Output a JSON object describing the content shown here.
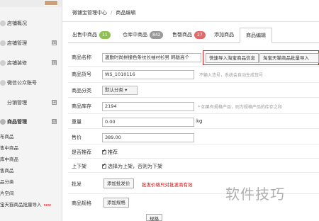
{
  "sidebar": {
    "items": [
      {
        "label": "店铺概况"
      },
      {
        "label": "店铺管理",
        "expand": "⊞"
      },
      {
        "label": "店铺装修",
        "expand": "⊞"
      },
      {
        "label": "微信公众账号"
      },
      {
        "label": "分销管理",
        "expand": "⊞"
      },
      {
        "label": "商品管理",
        "expand": "⊟"
      }
    ],
    "sub_items": [
      "布商品",
      "售中商品",
      "库中商品",
      "售商品",
      "品分类",
      "片空间",
      "宝天猫商品批量导入"
    ],
    "new_badge": "new"
  },
  "breadcrumb": {
    "root": "微铺宝管理中心",
    "sep": "/",
    "current": "商品编辑"
  },
  "tabs": [
    {
      "label": "出售中商品",
      "count": "11",
      "color": "#8fbf4f"
    },
    {
      "label": "仓库中商品",
      "count": "842",
      "color": "#9a9a9a"
    },
    {
      "label": "售罄商品",
      "count": "27",
      "color": "#e06a6a"
    },
    {
      "label": "添加商品"
    },
    {
      "label": "商品编辑"
    }
  ],
  "form": {
    "name": {
      "label": "商品名称",
      "value": "邊勤时尚拼撞色条纹长袖衬衫男 韩版高个",
      "btn_taobao": "快速导入淘宝商品信息",
      "btn_tmall": "淘宝天猫商品批量导入"
    },
    "sku": {
      "label": "商品货号",
      "value": "WS_1010116",
      "hint": "不输入货号，系统会自动生成货号"
    },
    "category": {
      "label": "商品分类",
      "value": "默认分类 ▾"
    },
    "stock": {
      "label": "商品库存",
      "value": "2194",
      "hint": "* 如果有规格产品，则为规格产品的库存之和"
    },
    "weight": {
      "label": "重量",
      "value": "0.00",
      "unit": "kg"
    },
    "price": {
      "label": "售价",
      "value": "389.00"
    },
    "recommend": {
      "label": "是否推荐",
      "option": "推荐"
    },
    "shelf": {
      "label": "上下架",
      "option": "选择为上架，否则为下架"
    },
    "batch": {
      "label": "批发",
      "btn": "添加批发价",
      "note": "批发价格只对批发商有效"
    },
    "spec": {
      "label": "商品规格",
      "btn": "添加规格",
      "sub_label": "规格"
    }
  },
  "watermark": "软件技巧"
}
